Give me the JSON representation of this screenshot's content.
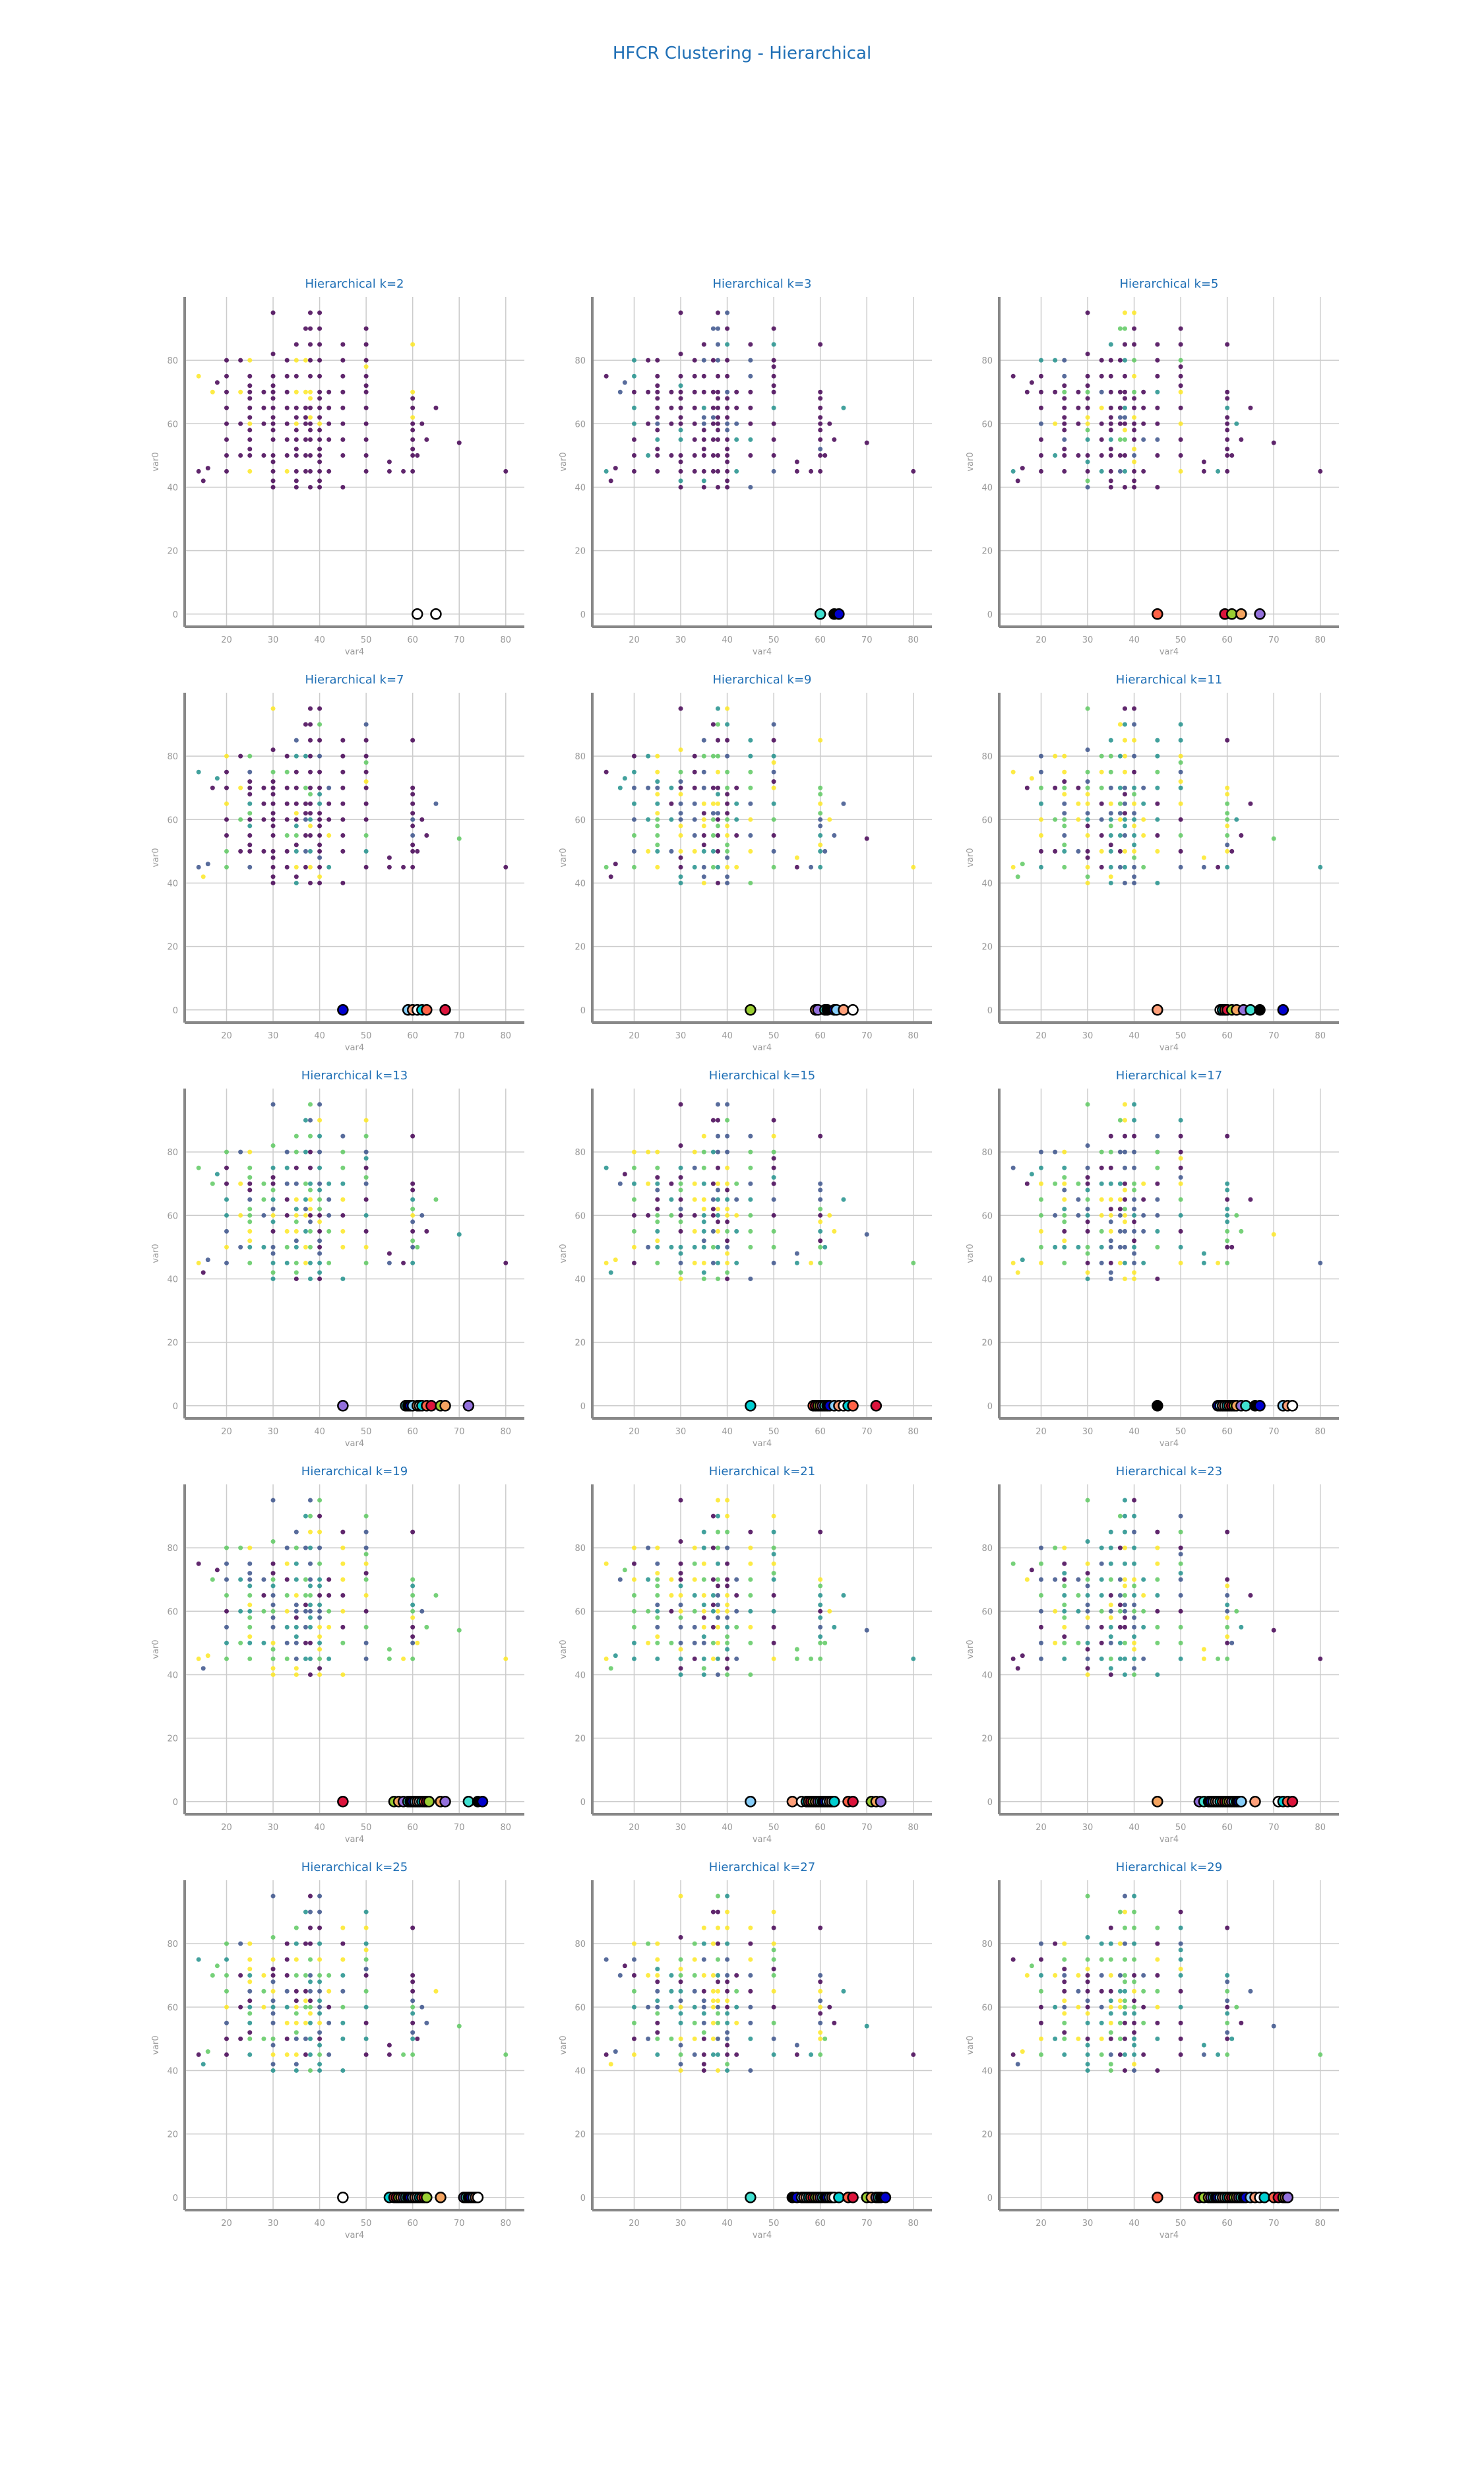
{
  "title": "HFCR Clustering - Hierarchical",
  "colors": {
    "title": "#1f6fb5",
    "axis_text": "#999999",
    "grid": "#cccccc",
    "spine": "#888888",
    "palette": [
      "#440154",
      "#3b528b",
      "#21918c",
      "#5ec962",
      "#fde725"
    ],
    "centroid_fills": [
      "#ffffff",
      "#40e0d0",
      "#ff6347",
      "#0000cd",
      "#9acd32",
      "#ffa07a",
      "#9370db",
      "#00ced1",
      "#000000",
      "#dc143c",
      "#87cefa",
      "#f4a460"
    ]
  },
  "chart_data": [
    {
      "title": "Hierarchical k=2",
      "k": 2,
      "type": "scatter",
      "xlabel": "var4",
      "ylabel": "var0",
      "centroid_x": [
        61,
        65
      ],
      "centroid_fills": [
        "#ffffff",
        "#ffffff"
      ]
    },
    {
      "title": "Hierarchical k=3",
      "k": 3,
      "type": "scatter",
      "xlabel": "var4",
      "ylabel": "var0",
      "centroid_x": [
        60,
        63,
        64
      ]
    },
    {
      "title": "Hierarchical k=5",
      "k": 5,
      "type": "scatter",
      "xlabel": "var4",
      "ylabel": "var0",
      "centroid_x": [
        45,
        59.5,
        61,
        63,
        67
      ]
    },
    {
      "title": "Hierarchical k=7",
      "k": 7,
      "type": "scatter",
      "xlabel": "var4",
      "ylabel": "var0",
      "centroid_x": [
        45,
        59,
        60,
        61,
        62,
        63,
        67
      ]
    },
    {
      "title": "Hierarchical k=9",
      "k": 9,
      "type": "scatter",
      "xlabel": "var4",
      "ylabel": "var0",
      "centroid_x": [
        45,
        59,
        59.5,
        61,
        61.5,
        63,
        63.5,
        65,
        67
      ]
    },
    {
      "title": "Hierarchical k=11",
      "k": 11,
      "type": "scatter",
      "xlabel": "var4",
      "ylabel": "var0",
      "centroid_x": [
        45,
        58.5,
        59,
        59.5,
        60,
        61,
        62,
        63.5,
        65,
        67,
        72
      ]
    },
    {
      "title": "Hierarchical k=13",
      "k": 13,
      "type": "scatter",
      "xlabel": "var4",
      "ylabel": "var0",
      "centroid_x": [
        45,
        58.5,
        59,
        59.5,
        60,
        61,
        61.5,
        62,
        63,
        64,
        66,
        67,
        72
      ]
    },
    {
      "title": "Hierarchical k=15",
      "k": 15,
      "type": "scatter",
      "xlabel": "var4",
      "ylabel": "var0",
      "centroid_x": [
        45,
        58.5,
        59,
        59.5,
        60,
        60.5,
        61,
        61.5,
        62,
        63,
        64,
        65,
        66,
        67,
        72
      ]
    },
    {
      "title": "Hierarchical k=17",
      "k": 17,
      "type": "scatter",
      "xlabel": "var4",
      "ylabel": "var0",
      "centroid_x": [
        45,
        58,
        58.5,
        59,
        59.5,
        60,
        60.5,
        61,
        61.5,
        62,
        63,
        64,
        66,
        67,
        72,
        73,
        74
      ]
    },
    {
      "title": "Hierarchical k=19",
      "k": 19,
      "type": "scatter",
      "xlabel": "var4",
      "ylabel": "var0",
      "centroid_x": [
        45,
        56,
        57,
        58,
        59,
        59.5,
        60,
        60.5,
        61,
        61.5,
        62,
        62.5,
        63,
        63.5,
        66,
        67,
        72,
        74,
        75
      ]
    },
    {
      "title": "Hierarchical k=21",
      "k": 21,
      "type": "scatter",
      "xlabel": "var4",
      "ylabel": "var0",
      "centroid_x": [
        45,
        54,
        56,
        57,
        57.5,
        58,
        58.5,
        59,
        59.5,
        60,
        60.5,
        61,
        61.5,
        62,
        62.5,
        63,
        66,
        67,
        71,
        72,
        73
      ]
    },
    {
      "title": "Hierarchical k=23",
      "k": 23,
      "type": "scatter",
      "xlabel": "var4",
      "ylabel": "var0",
      "centroid_x": [
        45,
        54,
        55,
        56,
        56.5,
        57,
        57.5,
        58,
        58.5,
        59,
        59.5,
        60,
        60.5,
        61,
        61.5,
        62,
        62.5,
        63,
        66,
        71,
        72,
        73,
        74
      ]
    },
    {
      "title": "Hierarchical k=25",
      "k": 25,
      "type": "scatter",
      "xlabel": "var4",
      "ylabel": "var0",
      "centroid_x": [
        45,
        55,
        56,
        56.5,
        57,
        57.5,
        58,
        58.5,
        59,
        59.5,
        60,
        60.5,
        61,
        61.5,
        62,
        62.5,
        63,
        66,
        71,
        71.5,
        72,
        72.5,
        73,
        73.5,
        74
      ]
    },
    {
      "title": "Hierarchical k=27",
      "k": 27,
      "type": "scatter",
      "xlabel": "var4",
      "ylabel": "var0",
      "centroid_x": [
        45,
        54,
        55,
        56,
        56.5,
        57,
        57.5,
        58,
        58.5,
        59,
        59.5,
        60,
        60.5,
        61,
        61.5,
        62,
        62.5,
        63,
        64,
        66,
        67,
        70,
        71,
        72,
        72.5,
        73,
        74
      ]
    },
    {
      "title": "Hierarchical k=29",
      "k": 29,
      "type": "scatter",
      "xlabel": "var4",
      "ylabel": "var0",
      "centroid_x": [
        45,
        54,
        55,
        56,
        56.5,
        57,
        57.5,
        58,
        58.5,
        59,
        59.5,
        60,
        60.5,
        61,
        61.5,
        62,
        62.5,
        63,
        63.5,
        64,
        65,
        66,
        67,
        68,
        70,
        71,
        72,
        72.5,
        73
      ]
    }
  ],
  "axes": {
    "xlim": [
      11,
      84
    ],
    "ylim": [
      -4,
      100
    ],
    "xticks": [
      20,
      30,
      40,
      50,
      60,
      70,
      80
    ],
    "yticks": [
      0,
      20,
      40,
      60,
      80
    ],
    "grid": true
  },
  "scatter_points": [
    [
      14,
      45
    ],
    [
      14,
      75
    ],
    [
      15,
      42
    ],
    [
      16,
      46
    ],
    [
      17,
      70
    ],
    [
      18,
      73
    ],
    [
      20,
      45
    ],
    [
      20,
      50
    ],
    [
      20,
      55
    ],
    [
      20,
      60
    ],
    [
      20,
      65
    ],
    [
      20,
      70
    ],
    [
      20,
      75
    ],
    [
      20,
      80
    ],
    [
      23,
      50
    ],
    [
      23,
      60
    ],
    [
      23,
      70
    ],
    [
      23,
      80
    ],
    [
      25,
      45
    ],
    [
      25,
      50
    ],
    [
      25,
      52
    ],
    [
      25,
      55
    ],
    [
      25,
      58
    ],
    [
      25,
      60
    ],
    [
      25,
      62
    ],
    [
      25,
      65
    ],
    [
      25,
      68
    ],
    [
      25,
      70
    ],
    [
      25,
      72
    ],
    [
      25,
      75
    ],
    [
      25,
      80
    ],
    [
      28,
      50
    ],
    [
      28,
      60
    ],
    [
      28,
      65
    ],
    [
      28,
      70
    ],
    [
      30,
      40
    ],
    [
      30,
      42
    ],
    [
      30,
      45
    ],
    [
      30,
      48
    ],
    [
      30,
      50
    ],
    [
      30,
      55
    ],
    [
      30,
      58
    ],
    [
      30,
      60
    ],
    [
      30,
      62
    ],
    [
      30,
      65
    ],
    [
      30,
      68
    ],
    [
      30,
      70
    ],
    [
      30,
      72
    ],
    [
      30,
      75
    ],
    [
      30,
      82
    ],
    [
      30,
      95
    ],
    [
      33,
      45
    ],
    [
      33,
      50
    ],
    [
      33,
      55
    ],
    [
      33,
      60
    ],
    [
      33,
      65
    ],
    [
      33,
      70
    ],
    [
      33,
      75
    ],
    [
      33,
      80
    ],
    [
      35,
      40
    ],
    [
      35,
      42
    ],
    [
      35,
      45
    ],
    [
      35,
      50
    ],
    [
      35,
      52
    ],
    [
      35,
      55
    ],
    [
      35,
      58
    ],
    [
      35,
      60
    ],
    [
      35,
      62
    ],
    [
      35,
      65
    ],
    [
      35,
      70
    ],
    [
      35,
      75
    ],
    [
      35,
      80
    ],
    [
      35,
      85
    ],
    [
      37,
      45
    ],
    [
      37,
      50
    ],
    [
      37,
      55
    ],
    [
      37,
      60
    ],
    [
      37,
      62
    ],
    [
      37,
      65
    ],
    [
      37,
      70
    ],
    [
      37,
      80
    ],
    [
      37,
      90
    ],
    [
      38,
      40
    ],
    [
      38,
      45
    ],
    [
      38,
      50
    ],
    [
      38,
      55
    ],
    [
      38,
      58
    ],
    [
      38,
      60
    ],
    [
      38,
      62
    ],
    [
      38,
      65
    ],
    [
      38,
      68
    ],
    [
      38,
      70
    ],
    [
      38,
      75
    ],
    [
      38,
      80
    ],
    [
      38,
      85
    ],
    [
      38,
      90
    ],
    [
      38,
      95
    ],
    [
      40,
      40
    ],
    [
      40,
      42
    ],
    [
      40,
      45
    ],
    [
      40,
      48
    ],
    [
      40,
      50
    ],
    [
      40,
      52
    ],
    [
      40,
      55
    ],
    [
      40,
      58
    ],
    [
      40,
      60
    ],
    [
      40,
      62
    ],
    [
      40,
      65
    ],
    [
      40,
      68
    ],
    [
      40,
      70
    ],
    [
      40,
      75
    ],
    [
      40,
      80
    ],
    [
      40,
      85
    ],
    [
      40,
      90
    ],
    [
      40,
      95
    ],
    [
      42,
      45
    ],
    [
      42,
      55
    ],
    [
      42,
      60
    ],
    [
      42,
      65
    ],
    [
      42,
      70
    ],
    [
      45,
      40
    ],
    [
      45,
      50
    ],
    [
      45,
      55
    ],
    [
      45,
      60
    ],
    [
      45,
      65
    ],
    [
      45,
      70
    ],
    [
      45,
      75
    ],
    [
      45,
      80
    ],
    [
      45,
      85
    ],
    [
      50,
      45
    ],
    [
      50,
      50
    ],
    [
      50,
      55
    ],
    [
      50,
      60
    ],
    [
      50,
      65
    ],
    [
      50,
      70
    ],
    [
      50,
      72
    ],
    [
      50,
      75
    ],
    [
      50,
      78
    ],
    [
      50,
      80
    ],
    [
      50,
      85
    ],
    [
      50,
      90
    ],
    [
      55,
      45
    ],
    [
      55,
      48
    ],
    [
      58,
      45
    ],
    [
      60,
      45
    ],
    [
      60,
      50
    ],
    [
      60,
      52
    ],
    [
      60,
      55
    ],
    [
      60,
      58
    ],
    [
      60,
      60
    ],
    [
      60,
      62
    ],
    [
      60,
      65
    ],
    [
      60,
      68
    ],
    [
      60,
      70
    ],
    [
      60,
      85
    ],
    [
      61,
      50
    ],
    [
      62,
      60
    ],
    [
      63,
      55
    ],
    [
      65,
      65
    ],
    [
      70,
      54
    ],
    [
      80,
      45
    ]
  ]
}
